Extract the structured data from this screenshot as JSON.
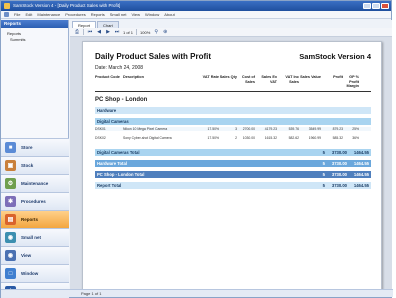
{
  "window": {
    "title": "SamStock Version 4 - [Daily Product Sales with Profit]"
  },
  "menu": [
    "File",
    "Edit",
    "Maintenance",
    "Procedures",
    "Reports",
    "Small net",
    "View",
    "Window",
    "About"
  ],
  "leftpane": {
    "header": "Reports",
    "tree": [
      "Reports",
      "Summits"
    ]
  },
  "nav": [
    {
      "label": "Store",
      "icon": "store-icon",
      "color": "#5b8bd6"
    },
    {
      "label": "Stock",
      "icon": "box-icon",
      "color": "#c9803b"
    },
    {
      "label": "Maintenance",
      "icon": "wrench-icon",
      "color": "#6f9f4e"
    },
    {
      "label": "Procedures",
      "icon": "gears-icon",
      "color": "#7d6fb8"
    },
    {
      "label": "Reports",
      "icon": "chart-icon",
      "color": "#d9642c"
    },
    {
      "label": "Small net",
      "icon": "network-icon",
      "color": "#3c8fb0"
    },
    {
      "label": "View",
      "icon": "eye-icon",
      "color": "#4a71b2"
    },
    {
      "label": "Window",
      "icon": "window-icon",
      "color": "#3f7fd0"
    },
    {
      "label": "About",
      "icon": "info-icon",
      "color": "#2a5aa6"
    }
  ],
  "tabs": [
    "Report",
    "Chart"
  ],
  "report_toolbar": {
    "page": "1 of 1",
    "zoom": "100%"
  },
  "report": {
    "title": "Daily Product Sales with Profit",
    "brand": "SamStock Version 4",
    "date": "Date: March 24, 2008",
    "columns": {
      "code": "Product Code",
      "desc": "Description",
      "vat": "VAT Rate",
      "qty": "Sales Qty",
      "cost": "Cost of Sales",
      "sexv": "Sales Ex VAT",
      "vatinc": "VAT Inc Sales",
      "sval": "Sales Value",
      "profit": "Profit",
      "gp": "GP % Profit Margin"
    },
    "shop": "PC Shop - London",
    "bands": {
      "hardware": "Hardware",
      "digital": "Digital Cameras",
      "digital_total": "Digital Cameras Total",
      "hardware_total": "Hardware Total",
      "shop_total": "PC Shop - London Total",
      "report_total": "Report Total"
    },
    "lines": [
      {
        "code": "DSK01",
        "desc": "Nikon 10 Mega Pixel Camera",
        "vat": "17.50%",
        "qty": "3",
        "cost": "2700.00",
        "sexv": "4179.23",
        "vatinc": "539.76",
        "sval": "3549.99",
        "profit": "879.23",
        "gp": "25%"
      },
      {
        "code": "DSK02",
        "desc": "Sony Cyber-shot Digital Camera",
        "vat": "17.50%",
        "qty": "2",
        "cost": "1030.00",
        "sexv": "1615.32",
        "vatinc": "582.62",
        "sval": "1960.99",
        "profit": "585.32",
        "gp": "36%"
      }
    ],
    "totals": {
      "digital": {
        "qty": "5",
        "cost": "3730.00",
        "profit": "1464.55"
      },
      "hardware": {
        "qty": "5",
        "cost": "3730.00",
        "profit": "1464.55"
      },
      "shop": {
        "qty": "5",
        "cost": "3730.00",
        "profit": "1464.55"
      },
      "report": {
        "qty": "5",
        "cost": "3730.00",
        "profit": "1464.55"
      }
    }
  },
  "status": {
    "page": "Page 1 of 1"
  }
}
